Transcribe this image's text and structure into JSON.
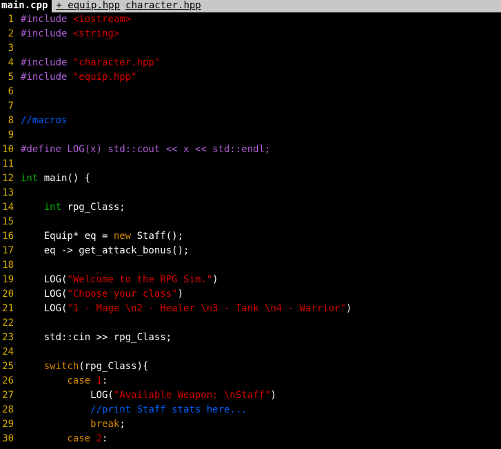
{
  "tabs": [
    {
      "label": "main.cpp",
      "active": true
    },
    {
      "label": "+ equip.hpp",
      "active": false
    },
    {
      "label": "character.hpp",
      "active": false
    }
  ],
  "colors": {
    "background": "#000000",
    "line_number": "#d7af00",
    "preprocessor": "#af5fd7",
    "string": "#d70000",
    "comment": "#005fff",
    "type": "#00af00",
    "keyword": "#d78700"
  },
  "lines": [
    {
      "n": "1",
      "tokens": [
        {
          "t": "#include ",
          "c": "pre"
        },
        {
          "t": "<iostream>",
          "c": "str"
        }
      ]
    },
    {
      "n": "2",
      "tokens": [
        {
          "t": "#include ",
          "c": "pre"
        },
        {
          "t": "<string>",
          "c": "str"
        }
      ]
    },
    {
      "n": "3",
      "tokens": []
    },
    {
      "n": "4",
      "tokens": [
        {
          "t": "#include ",
          "c": "pre"
        },
        {
          "t": "\"character.hpp\"",
          "c": "str"
        }
      ]
    },
    {
      "n": "5",
      "tokens": [
        {
          "t": "#include ",
          "c": "pre"
        },
        {
          "t": "\"equip.hpp\"",
          "c": "str"
        }
      ]
    },
    {
      "n": "6",
      "tokens": []
    },
    {
      "n": "7",
      "tokens": []
    },
    {
      "n": "8",
      "tokens": [
        {
          "t": "//macros",
          "c": "cmt"
        }
      ]
    },
    {
      "n": "9",
      "tokens": []
    },
    {
      "n": "10",
      "tokens": [
        {
          "t": "#define LOG(x) std::cout << x << std::endl;",
          "c": "pre"
        }
      ]
    },
    {
      "n": "11",
      "tokens": []
    },
    {
      "n": "12",
      "tokens": [
        {
          "t": "int",
          "c": "type"
        },
        {
          "t": " main() {",
          "c": "plain"
        }
      ]
    },
    {
      "n": "13",
      "tokens": []
    },
    {
      "n": "14",
      "tokens": [
        {
          "t": "    ",
          "c": "plain"
        },
        {
          "t": "int",
          "c": "type"
        },
        {
          "t": " rpg_Class;",
          "c": "plain"
        }
      ]
    },
    {
      "n": "15",
      "tokens": []
    },
    {
      "n": "16",
      "tokens": [
        {
          "t": "    Equip* eq = ",
          "c": "plain"
        },
        {
          "t": "new",
          "c": "kw"
        },
        {
          "t": " Staff();",
          "c": "plain"
        }
      ]
    },
    {
      "n": "17",
      "tokens": [
        {
          "t": "    eq -> get_attack_bonus();",
          "c": "plain"
        }
      ]
    },
    {
      "n": "18",
      "tokens": []
    },
    {
      "n": "19",
      "tokens": [
        {
          "t": "    LOG(",
          "c": "plain"
        },
        {
          "t": "\"Welcome to the RPG Sim.\"",
          "c": "str"
        },
        {
          "t": ")",
          "c": "plain"
        }
      ]
    },
    {
      "n": "20",
      "tokens": [
        {
          "t": "    LOG(",
          "c": "plain"
        },
        {
          "t": "\"Choose your class\"",
          "c": "str"
        },
        {
          "t": ")",
          "c": "plain"
        }
      ]
    },
    {
      "n": "21",
      "tokens": [
        {
          "t": "    LOG(",
          "c": "plain"
        },
        {
          "t": "\"1 - Mage \\n2 - Healer \\n3 - Tank \\n4 - Warrior\"",
          "c": "str"
        },
        {
          "t": ")",
          "c": "plain"
        }
      ]
    },
    {
      "n": "22",
      "tokens": []
    },
    {
      "n": "23",
      "tokens": [
        {
          "t": "    std::cin >> rpg_Class;",
          "c": "plain"
        }
      ]
    },
    {
      "n": "24",
      "tokens": []
    },
    {
      "n": "25",
      "tokens": [
        {
          "t": "    ",
          "c": "plain"
        },
        {
          "t": "switch",
          "c": "kw"
        },
        {
          "t": "(rpg_Class){",
          "c": "plain"
        }
      ]
    },
    {
      "n": "26",
      "tokens": [
        {
          "t": "        ",
          "c": "plain"
        },
        {
          "t": "case",
          "c": "kw"
        },
        {
          "t": " ",
          "c": "plain"
        },
        {
          "t": "1",
          "c": "num"
        },
        {
          "t": ":",
          "c": "plain"
        }
      ]
    },
    {
      "n": "27",
      "tokens": [
        {
          "t": "            LOG(",
          "c": "plain"
        },
        {
          "t": "\"Available Weapon: \\nStaff\"",
          "c": "str"
        },
        {
          "t": ")",
          "c": "plain"
        }
      ]
    },
    {
      "n": "28",
      "tokens": [
        {
          "t": "            ",
          "c": "plain"
        },
        {
          "t": "//print Staff stats here...",
          "c": "cmt"
        }
      ]
    },
    {
      "n": "29",
      "tokens": [
        {
          "t": "            ",
          "c": "plain"
        },
        {
          "t": "break",
          "c": "kw"
        },
        {
          "t": ";",
          "c": "plain"
        }
      ]
    },
    {
      "n": "30",
      "tokens": [
        {
          "t": "        ",
          "c": "plain"
        },
        {
          "t": "case",
          "c": "kw"
        },
        {
          "t": " ",
          "c": "plain"
        },
        {
          "t": "2",
          "c": "num"
        },
        {
          "t": ":",
          "c": "plain"
        }
      ]
    }
  ]
}
